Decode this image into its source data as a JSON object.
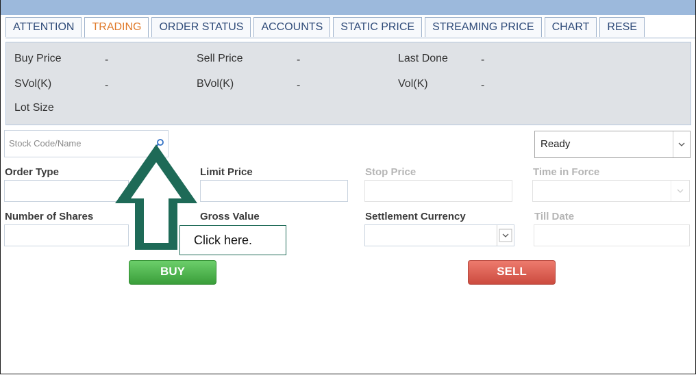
{
  "tabs": [
    {
      "label": "ATTENTION",
      "active": false
    },
    {
      "label": "TRADING",
      "active": true
    },
    {
      "label": "ORDER STATUS",
      "active": false
    },
    {
      "label": "ACCOUNTS",
      "active": false
    },
    {
      "label": "STATIC PRICE",
      "active": false
    },
    {
      "label": "STREAMING PRICE",
      "active": false
    },
    {
      "label": "CHART",
      "active": false
    },
    {
      "label": "RESE",
      "active": false
    }
  ],
  "quote": {
    "buy_price_label": "Buy Price",
    "buy_price_value": "-",
    "sell_price_label": "Sell Price",
    "sell_price_value": "-",
    "last_done_label": "Last Done",
    "last_done_value": "-",
    "svol_label": "SVol(K)",
    "svol_value": "-",
    "bvol_label": "BVol(K)",
    "bvol_value": "-",
    "vol_label": "Vol(K)",
    "vol_value": "-",
    "lot_size_label": "Lot Size"
  },
  "search": {
    "placeholder": "Stock Code/Name",
    "icon": "search-icon"
  },
  "status_select": {
    "value": "Ready"
  },
  "form": {
    "order_type": "Order Type",
    "limit_price": "Limit Price",
    "stop_price": "Stop Price",
    "time_in_force": "Time in Force",
    "number_of_shares": "Number of Shares",
    "gross_value": "Gross Value",
    "settlement_currency": "Settlement Currency",
    "till_date": "Till Date"
  },
  "buttons": {
    "buy": "BUY",
    "sell": "SELL"
  },
  "callout": {
    "text": "Click here."
  },
  "colors": {
    "active_tab": "#e07a2a",
    "buy": "#4cb34c",
    "sell": "#dc5b4f",
    "callout": "#1e6a57",
    "topbar": "#9cb9dc"
  }
}
